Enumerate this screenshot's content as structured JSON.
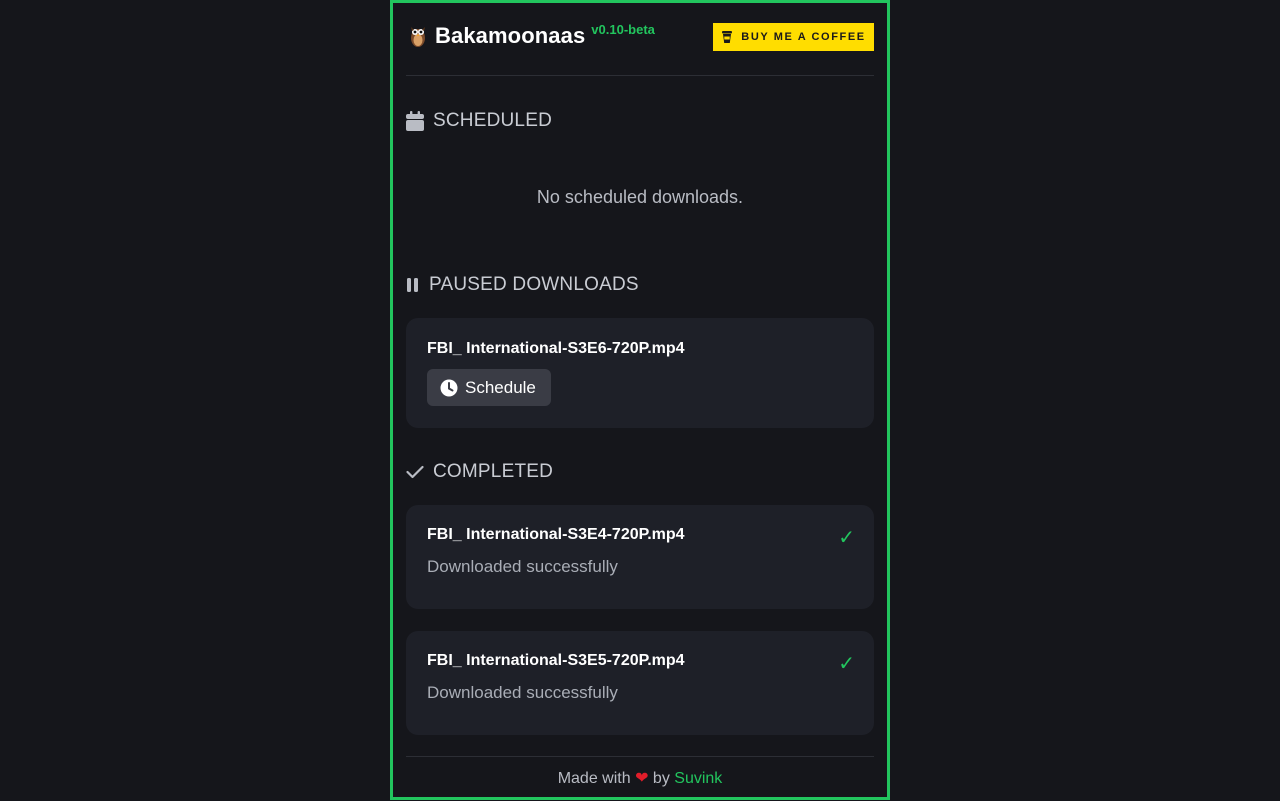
{
  "header": {
    "title": "Bakamoonaas",
    "version": "v0.10-beta",
    "coffee_label": "BUY ME A COFFEE"
  },
  "scheduled": {
    "heading": "SCHEDULED",
    "empty_message": "No scheduled downloads."
  },
  "paused": {
    "heading": "PAUSED DOWNLOADS",
    "items": [
      {
        "file": "FBI_ International-S3E6-720P.mp4",
        "action_label": "Schedule"
      }
    ]
  },
  "completed": {
    "heading": "COMPLETED",
    "items": [
      {
        "file": "FBI_ International-S3E4-720P.mp4",
        "status": "Downloaded successfully",
        "mark": "✓"
      },
      {
        "file": "FBI_ International-S3E5-720P.mp4",
        "status": "Downloaded successfully",
        "mark": "✓"
      }
    ]
  },
  "footer": {
    "prefix": "Made with",
    "heart": "❤",
    "by": "by",
    "author": "Suvink"
  },
  "colors": {
    "accent": "#22c55e",
    "background": "#15161b",
    "card": "#1e2028",
    "coffee": "#ffdd00"
  }
}
